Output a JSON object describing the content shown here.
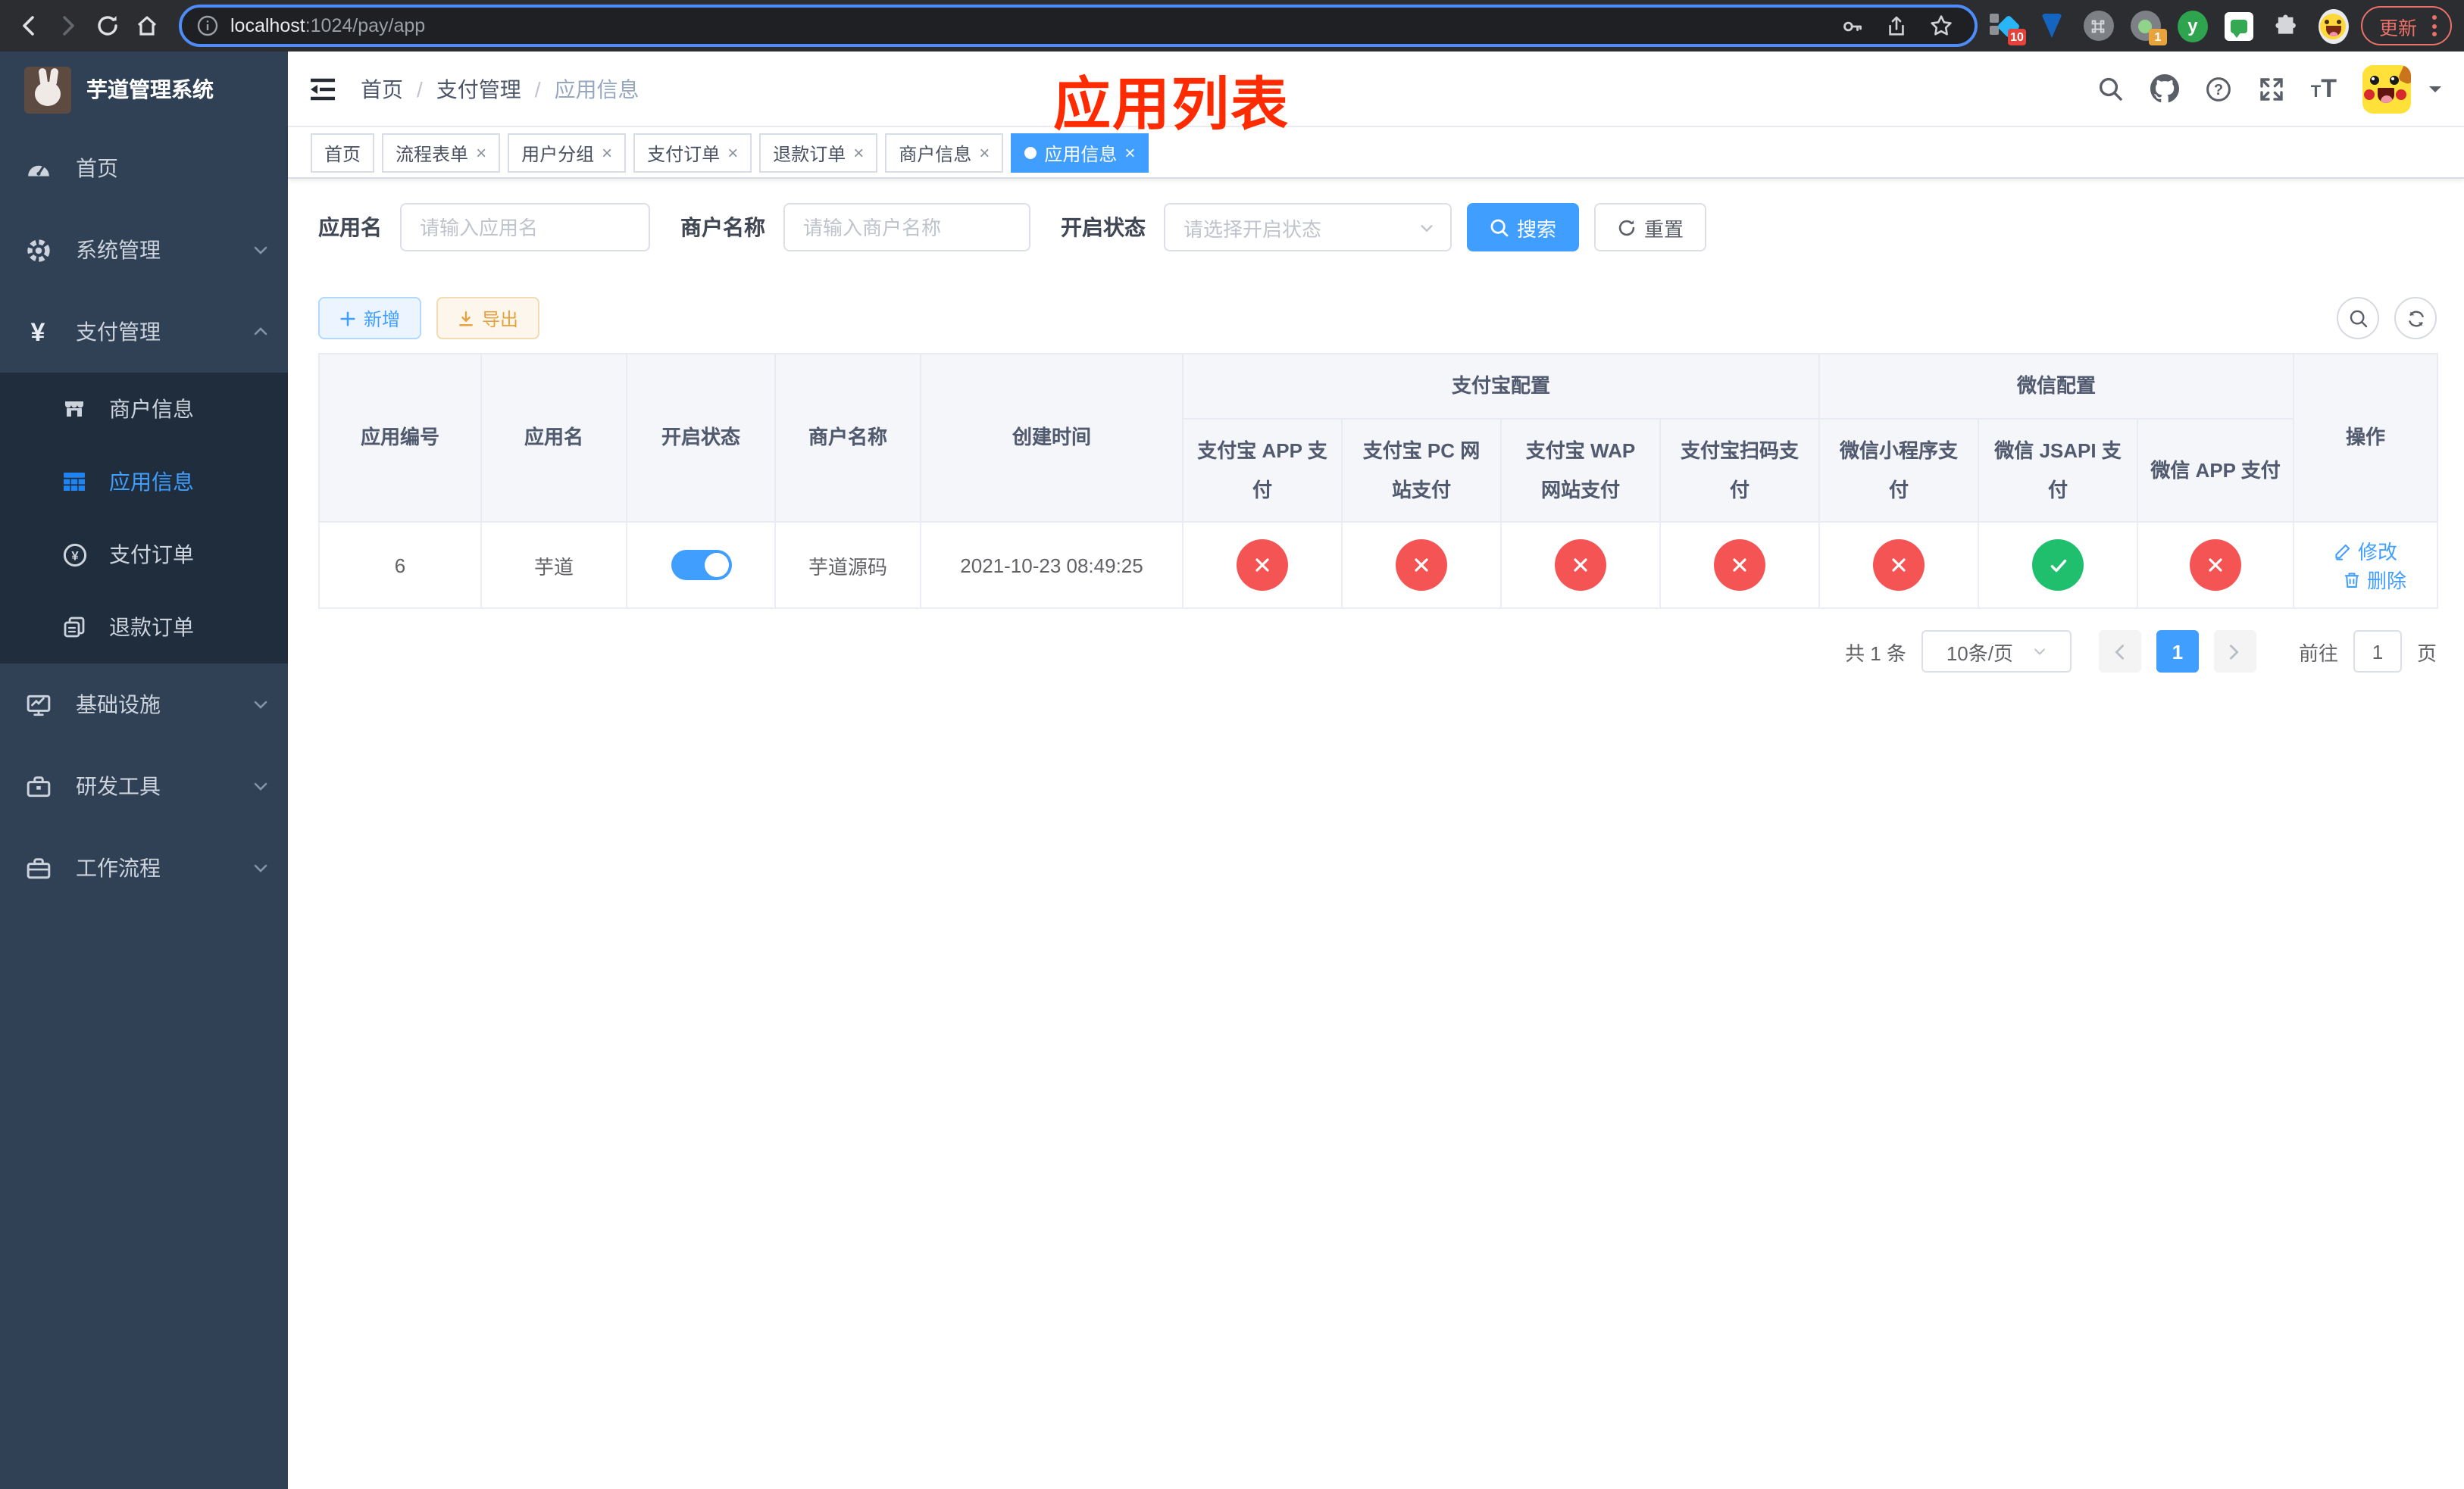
{
  "browser": {
    "url_host": "localhost",
    "url_path": ":1024/pay/app",
    "ext_y_label": "y",
    "ext_badge_1": "10",
    "ext_badge_2": "1",
    "update_label": "更新"
  },
  "sidebar": {
    "title": "芋道管理系统",
    "items": {
      "home": "首页",
      "system": "系统管理",
      "pay": "支付管理",
      "infra": "基础设施",
      "devtool": "研发工具",
      "workflow": "工作流程"
    },
    "submenu": {
      "merchant": "商户信息",
      "app": "应用信息",
      "order": "支付订单",
      "refund": "退款订单"
    },
    "pay_icon_char": "¥",
    "order_icon_char": "¥"
  },
  "topnav": {
    "breadcrumb": [
      "首页",
      "支付管理",
      "应用信息"
    ],
    "separator": "/",
    "font_icon_small": "T",
    "font_icon_big": "T"
  },
  "annotation": "应用列表",
  "tags": [
    {
      "label": "首页"
    },
    {
      "label": "流程表单"
    },
    {
      "label": "用户分组"
    },
    {
      "label": "支付订单"
    },
    {
      "label": "退款订单"
    },
    {
      "label": "商户信息"
    },
    {
      "label": "应用信息"
    }
  ],
  "close_glyph": "×",
  "filters": {
    "app_name_label": "应用名",
    "app_name_placeholder": "请输入应用名",
    "merchant_label": "商户名称",
    "merchant_placeholder": "请输入商户名称",
    "status_label": "开启状态",
    "status_placeholder": "请选择开启状态",
    "search_label": "搜索",
    "reset_label": "重置"
  },
  "toolbar": {
    "add_label": "新增",
    "export_label": "导出"
  },
  "table": {
    "group_alipay": "支付宝配置",
    "group_wechat": "微信配置",
    "columns": [
      "应用编号",
      "应用名",
      "开启状态",
      "商户名称",
      "创建时间",
      "支付宝 APP 支付",
      "支付宝 PC 网站支付",
      "支付宝 WAP 网站支付",
      "支付宝扫码支付",
      "微信小程序支付",
      "微信 JSAPI 支付",
      "微信 APP 支付",
      "操作"
    ],
    "row": {
      "id": "6",
      "name": "芋道",
      "switch_on": true,
      "merchant": "芋道源码",
      "created": "2021-10-23 08:49:25",
      "payment_states": [
        "no",
        "no",
        "no",
        "no",
        "no",
        "yes",
        "no"
      ],
      "edit_label": "修改",
      "delete_label": "删除"
    }
  },
  "pagination": {
    "total_label": "共 1 条",
    "page_size_label": "10条/页",
    "current_page": "1",
    "goto_label": "前往",
    "goto_value": "1",
    "page_suffix": "页"
  },
  "colors": {
    "primary": "#409eff",
    "success_circle": "#20bf6e",
    "danger_circle": "#f45454",
    "sidebar_bg": "#304156",
    "submenu_bg": "#1f2d3d",
    "annotation_red": "#ff2b00"
  }
}
